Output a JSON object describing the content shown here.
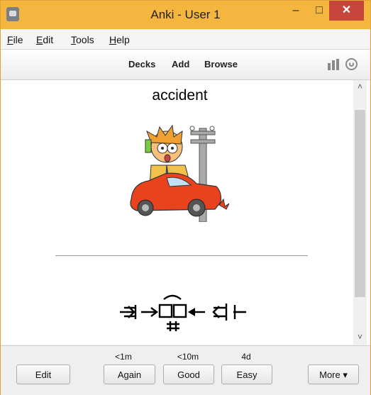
{
  "window": {
    "title": "Anki - User 1"
  },
  "titlebar": {
    "minimize": "–",
    "maximize": "□",
    "close": "✕"
  },
  "menu": [
    {
      "label": "File",
      "underline": "F",
      "rest": "ile"
    },
    {
      "label": "Edit",
      "underline": "E",
      "rest": "dit"
    },
    {
      "label": "Tools",
      "underline": "T",
      "rest": "ools"
    },
    {
      "label": "Help",
      "underline": "H",
      "rest": "elp"
    }
  ],
  "toolbar": {
    "decks": "Decks",
    "add": "Add",
    "browse": "Browse"
  },
  "card": {
    "front_word": "accident"
  },
  "scrollbar": {
    "up": "˄",
    "down": "˅"
  },
  "answer": {
    "edit": "Edit",
    "more": "More ▾",
    "buttons": [
      {
        "label": "Again",
        "interval": "<1m"
      },
      {
        "label": "Good",
        "interval": "<10m"
      },
      {
        "label": "Easy",
        "interval": "4d"
      }
    ]
  },
  "colors": {
    "titlebar": "#f4b63f",
    "close": "#c7463c"
  }
}
